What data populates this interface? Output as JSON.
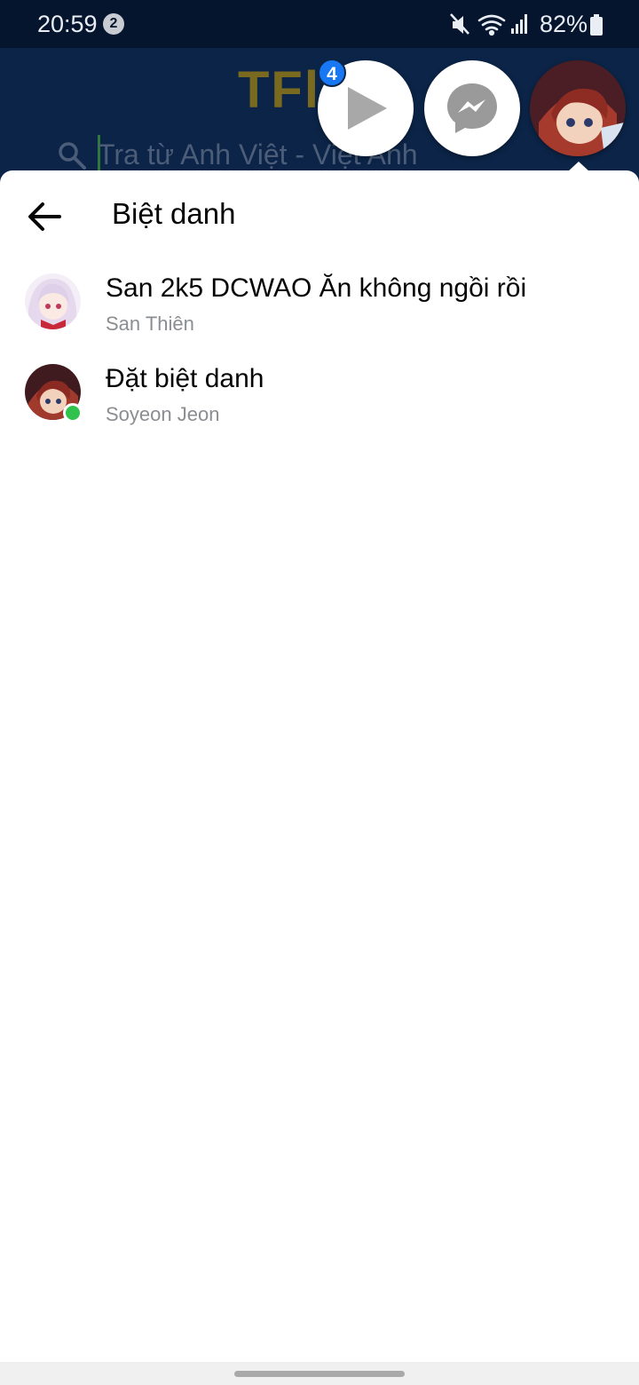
{
  "status_bar": {
    "time": "20:59",
    "notification_count": "2",
    "battery": "82%",
    "icons": [
      "mute-icon",
      "wifi-icon",
      "signal-icon",
      "battery-icon"
    ]
  },
  "background_app": {
    "logo": "TFla",
    "search_placeholder": "Tra từ Anh Việt - Việt Anh"
  },
  "chat_heads": {
    "play_badge": "4"
  },
  "panel": {
    "title": "Biệt danh",
    "members": [
      {
        "nickname": "San 2k5 DCWAO Ăn không ngồi rồi",
        "name": "San Thiên",
        "online": false
      },
      {
        "nickname": "Đặt biệt danh",
        "name": "Soyeon Jeon",
        "online": true
      }
    ]
  },
  "colors": {
    "messenger_blue": "#1877f2",
    "online_green": "#31c24d",
    "status_bar_bg": "#06152e",
    "app_bg": "#0b2447"
  }
}
